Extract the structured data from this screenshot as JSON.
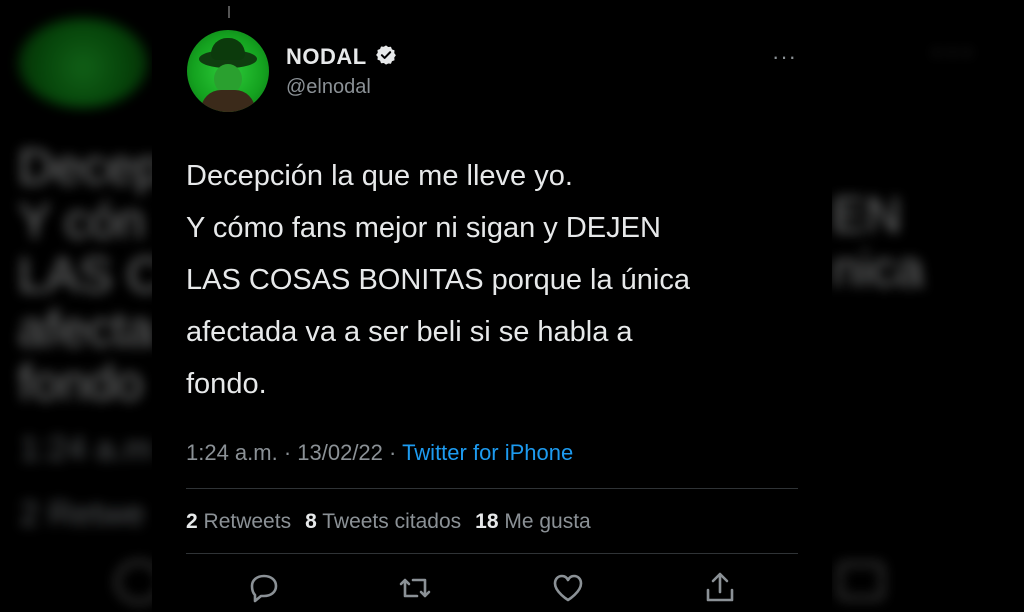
{
  "tweet": {
    "name": "NODAL",
    "handle": "@elnodal",
    "text": "Decepción la que me lleve yo.\n Y cómo fans mejor ni sigan y DEJEN\nLAS COSAS BONITAS porque la única\nafectada va a ser beli si se habla a\nfondo.",
    "time": "1:24 a.m. · 13/02/22 · ",
    "source": "Twitter for iPhone",
    "stats": {
      "retweets_count": "2",
      "retweets_label": "Retweets",
      "quotes_count": "8",
      "quotes_label": "Tweets citados",
      "likes_count": "18",
      "likes_label": "Me gusta"
    },
    "more_label": "···"
  },
  "background": {
    "text_left": "Decep\n Y cón\nLAS C\nafecta\nfondo",
    "text_right": "EN\nnica",
    "time": "1:24 a.m",
    "retweets": "2 Retwe"
  },
  "colors": {
    "background": "#000000",
    "text": "#e7e9ea",
    "muted": "#8b9196",
    "link": "#1d9bf0",
    "divider": "#2f3336"
  },
  "icons": [
    "verified-badge-icon",
    "more-icon",
    "reply-icon",
    "retweet-icon",
    "like-icon",
    "share-icon"
  ]
}
